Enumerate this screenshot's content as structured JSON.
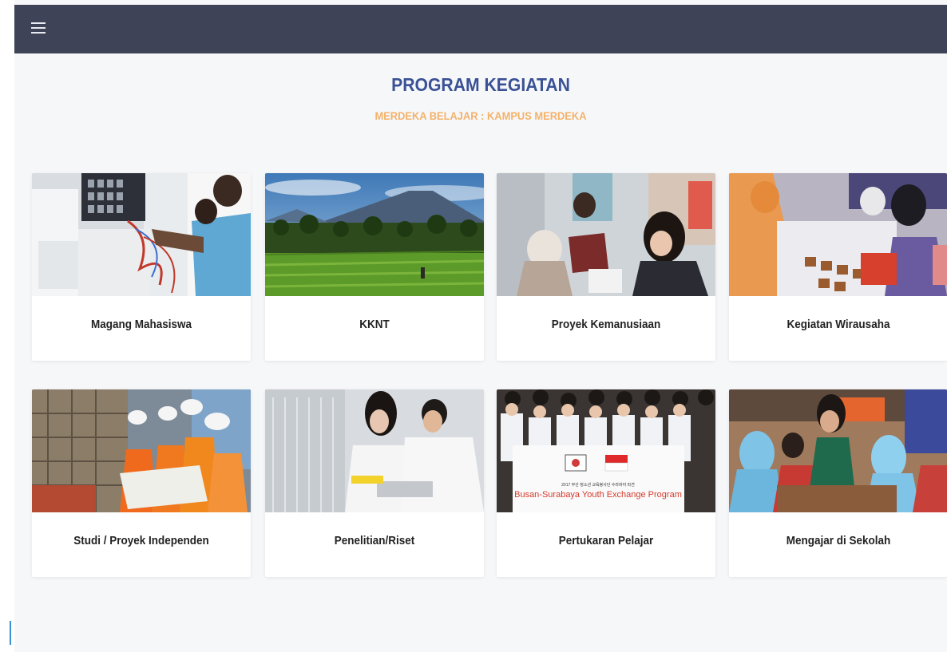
{
  "header": {
    "menu_icon": "hamburger-menu-icon"
  },
  "heading": {
    "title": "PROGRAM KEGIATAN",
    "subtitle": "MERDEKA BELAJAR : KAMPUS MERDEKA"
  },
  "programs": [
    {
      "label": "Magang Mahasiswa",
      "image": "internship-lab-photo"
    },
    {
      "label": "KKNT",
      "image": "rice-field-volcano-photo"
    },
    {
      "label": "Proyek Kemanusiaan",
      "image": "humanitarian-project-photo"
    },
    {
      "label": "Kegiatan Wirausaha",
      "image": "entrepreneur-bazaar-photo"
    },
    {
      "label": "Studi / Proyek Independen",
      "image": "construction-workers-photo"
    },
    {
      "label": "Penelitian/Riset",
      "image": "research-lab-photo"
    },
    {
      "label": "Pertukaran Pelajar",
      "image": "youth-exchange-group-photo",
      "banner_text": "Busan-Surabaya Youth Exchange Program"
    },
    {
      "label": "Mengajar di Sekolah",
      "image": "classroom-teaching-photo"
    }
  ],
  "colors": {
    "topbar": "#3f4357",
    "title": "#3a5195",
    "subtitle": "#f4b26b",
    "background": "#f6f7f9"
  }
}
